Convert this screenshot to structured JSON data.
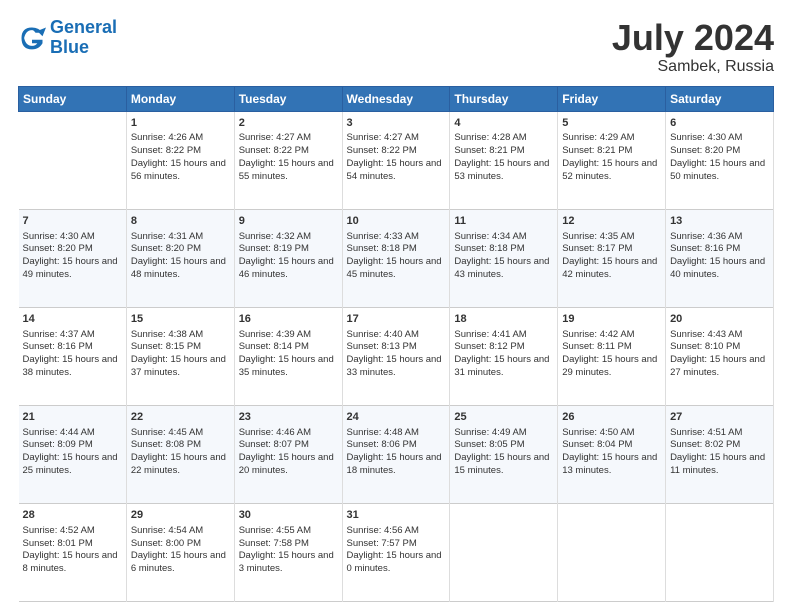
{
  "header": {
    "logo_line1": "General",
    "logo_line2": "Blue",
    "month": "July 2024",
    "location": "Sambek, Russia"
  },
  "days_of_week": [
    "Sunday",
    "Monday",
    "Tuesday",
    "Wednesday",
    "Thursday",
    "Friday",
    "Saturday"
  ],
  "weeks": [
    [
      {
        "day": "",
        "sunrise": "",
        "sunset": "",
        "daylight": ""
      },
      {
        "day": "1",
        "sunrise": "Sunrise: 4:26 AM",
        "sunset": "Sunset: 8:22 PM",
        "daylight": "Daylight: 15 hours and 56 minutes."
      },
      {
        "day": "2",
        "sunrise": "Sunrise: 4:27 AM",
        "sunset": "Sunset: 8:22 PM",
        "daylight": "Daylight: 15 hours and 55 minutes."
      },
      {
        "day": "3",
        "sunrise": "Sunrise: 4:27 AM",
        "sunset": "Sunset: 8:22 PM",
        "daylight": "Daylight: 15 hours and 54 minutes."
      },
      {
        "day": "4",
        "sunrise": "Sunrise: 4:28 AM",
        "sunset": "Sunset: 8:21 PM",
        "daylight": "Daylight: 15 hours and 53 minutes."
      },
      {
        "day": "5",
        "sunrise": "Sunrise: 4:29 AM",
        "sunset": "Sunset: 8:21 PM",
        "daylight": "Daylight: 15 hours and 52 minutes."
      },
      {
        "day": "6",
        "sunrise": "Sunrise: 4:30 AM",
        "sunset": "Sunset: 8:20 PM",
        "daylight": "Daylight: 15 hours and 50 minutes."
      }
    ],
    [
      {
        "day": "7",
        "sunrise": "Sunrise: 4:30 AM",
        "sunset": "Sunset: 8:20 PM",
        "daylight": "Daylight: 15 hours and 49 minutes."
      },
      {
        "day": "8",
        "sunrise": "Sunrise: 4:31 AM",
        "sunset": "Sunset: 8:20 PM",
        "daylight": "Daylight: 15 hours and 48 minutes."
      },
      {
        "day": "9",
        "sunrise": "Sunrise: 4:32 AM",
        "sunset": "Sunset: 8:19 PM",
        "daylight": "Daylight: 15 hours and 46 minutes."
      },
      {
        "day": "10",
        "sunrise": "Sunrise: 4:33 AM",
        "sunset": "Sunset: 8:18 PM",
        "daylight": "Daylight: 15 hours and 45 minutes."
      },
      {
        "day": "11",
        "sunrise": "Sunrise: 4:34 AM",
        "sunset": "Sunset: 8:18 PM",
        "daylight": "Daylight: 15 hours and 43 minutes."
      },
      {
        "day": "12",
        "sunrise": "Sunrise: 4:35 AM",
        "sunset": "Sunset: 8:17 PM",
        "daylight": "Daylight: 15 hours and 42 minutes."
      },
      {
        "day": "13",
        "sunrise": "Sunrise: 4:36 AM",
        "sunset": "Sunset: 8:16 PM",
        "daylight": "Daylight: 15 hours and 40 minutes."
      }
    ],
    [
      {
        "day": "14",
        "sunrise": "Sunrise: 4:37 AM",
        "sunset": "Sunset: 8:16 PM",
        "daylight": "Daylight: 15 hours and 38 minutes."
      },
      {
        "day": "15",
        "sunrise": "Sunrise: 4:38 AM",
        "sunset": "Sunset: 8:15 PM",
        "daylight": "Daylight: 15 hours and 37 minutes."
      },
      {
        "day": "16",
        "sunrise": "Sunrise: 4:39 AM",
        "sunset": "Sunset: 8:14 PM",
        "daylight": "Daylight: 15 hours and 35 minutes."
      },
      {
        "day": "17",
        "sunrise": "Sunrise: 4:40 AM",
        "sunset": "Sunset: 8:13 PM",
        "daylight": "Daylight: 15 hours and 33 minutes."
      },
      {
        "day": "18",
        "sunrise": "Sunrise: 4:41 AM",
        "sunset": "Sunset: 8:12 PM",
        "daylight": "Daylight: 15 hours and 31 minutes."
      },
      {
        "day": "19",
        "sunrise": "Sunrise: 4:42 AM",
        "sunset": "Sunset: 8:11 PM",
        "daylight": "Daylight: 15 hours and 29 minutes."
      },
      {
        "day": "20",
        "sunrise": "Sunrise: 4:43 AM",
        "sunset": "Sunset: 8:10 PM",
        "daylight": "Daylight: 15 hours and 27 minutes."
      }
    ],
    [
      {
        "day": "21",
        "sunrise": "Sunrise: 4:44 AM",
        "sunset": "Sunset: 8:09 PM",
        "daylight": "Daylight: 15 hours and 25 minutes."
      },
      {
        "day": "22",
        "sunrise": "Sunrise: 4:45 AM",
        "sunset": "Sunset: 8:08 PM",
        "daylight": "Daylight: 15 hours and 22 minutes."
      },
      {
        "day": "23",
        "sunrise": "Sunrise: 4:46 AM",
        "sunset": "Sunset: 8:07 PM",
        "daylight": "Daylight: 15 hours and 20 minutes."
      },
      {
        "day": "24",
        "sunrise": "Sunrise: 4:48 AM",
        "sunset": "Sunset: 8:06 PM",
        "daylight": "Daylight: 15 hours and 18 minutes."
      },
      {
        "day": "25",
        "sunrise": "Sunrise: 4:49 AM",
        "sunset": "Sunset: 8:05 PM",
        "daylight": "Daylight: 15 hours and 15 minutes."
      },
      {
        "day": "26",
        "sunrise": "Sunrise: 4:50 AM",
        "sunset": "Sunset: 8:04 PM",
        "daylight": "Daylight: 15 hours and 13 minutes."
      },
      {
        "day": "27",
        "sunrise": "Sunrise: 4:51 AM",
        "sunset": "Sunset: 8:02 PM",
        "daylight": "Daylight: 15 hours and 11 minutes."
      }
    ],
    [
      {
        "day": "28",
        "sunrise": "Sunrise: 4:52 AM",
        "sunset": "Sunset: 8:01 PM",
        "daylight": "Daylight: 15 hours and 8 minutes."
      },
      {
        "day": "29",
        "sunrise": "Sunrise: 4:54 AM",
        "sunset": "Sunset: 8:00 PM",
        "daylight": "Daylight: 15 hours and 6 minutes."
      },
      {
        "day": "30",
        "sunrise": "Sunrise: 4:55 AM",
        "sunset": "Sunset: 7:58 PM",
        "daylight": "Daylight: 15 hours and 3 minutes."
      },
      {
        "day": "31",
        "sunrise": "Sunrise: 4:56 AM",
        "sunset": "Sunset: 7:57 PM",
        "daylight": "Daylight: 15 hours and 0 minutes."
      },
      {
        "day": "",
        "sunrise": "",
        "sunset": "",
        "daylight": ""
      },
      {
        "day": "",
        "sunrise": "",
        "sunset": "",
        "daylight": ""
      },
      {
        "day": "",
        "sunrise": "",
        "sunset": "",
        "daylight": ""
      }
    ]
  ]
}
